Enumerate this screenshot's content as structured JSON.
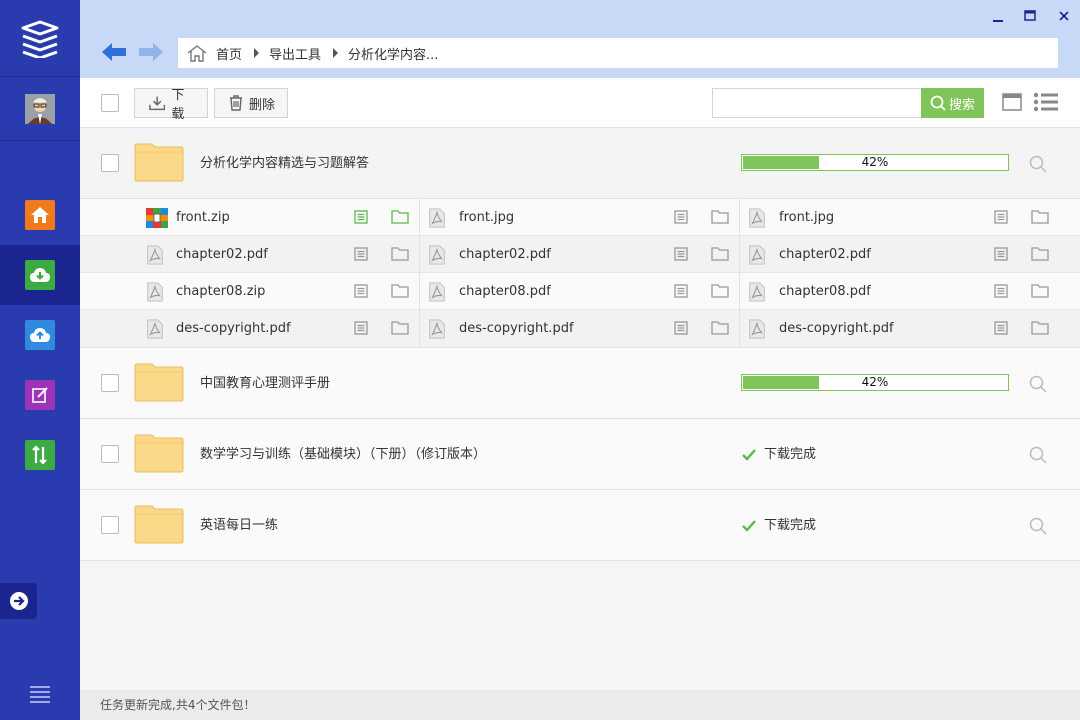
{
  "window": {
    "minimize": "–",
    "maximize": "□",
    "close": "✕"
  },
  "breadcrumb": [
    "首页",
    "导出工具",
    "分析化学内容..."
  ],
  "toolbar": {
    "download_label": "下载",
    "delete_label": "删除",
    "search_placeholder": "",
    "search_label": "搜索"
  },
  "tasks": [
    {
      "name": "分析化学内容精选与习题解答",
      "status": "progress",
      "progress": 0.42,
      "progress_text": "42%"
    },
    {
      "name": "中国教育心理测评手册",
      "status": "progress",
      "progress": 0.42,
      "progress_text": "42%"
    },
    {
      "name": "数学学习与训练（基础模块）（下册）（修订版本）",
      "status": "done",
      "status_text": "下载完成"
    },
    {
      "name": "英语每日一练",
      "status": "done",
      "status_text": "下载完成"
    }
  ],
  "files": [
    [
      {
        "name": "front.zip",
        "type": "zip"
      },
      {
        "name": "front.jpg",
        "type": "pdf"
      },
      {
        "name": "front.jpg",
        "type": "pdf"
      }
    ],
    [
      {
        "name": "chapter02.pdf",
        "type": "pdf"
      },
      {
        "name": "chapter02.pdf",
        "type": "pdf"
      },
      {
        "name": "chapter02.pdf",
        "type": "pdf"
      }
    ],
    [
      {
        "name": "chapter08.zip",
        "type": "pdf"
      },
      {
        "name": "chapter08.pdf",
        "type": "pdf"
      },
      {
        "name": "chapter08.pdf",
        "type": "pdf"
      }
    ],
    [
      {
        "name": "des-copyright.pdf",
        "type": "pdf"
      },
      {
        "name": "des-copyright.pdf",
        "type": "pdf"
      },
      {
        "name": "des-copyright.pdf",
        "type": "pdf"
      }
    ]
  ],
  "status_bar": "任务更新完成,共4个文件包！",
  "colors": {
    "sidebar": "#2a3bb0",
    "accent_green": "#7fc55a",
    "titlebar": "#c7d9f7"
  }
}
